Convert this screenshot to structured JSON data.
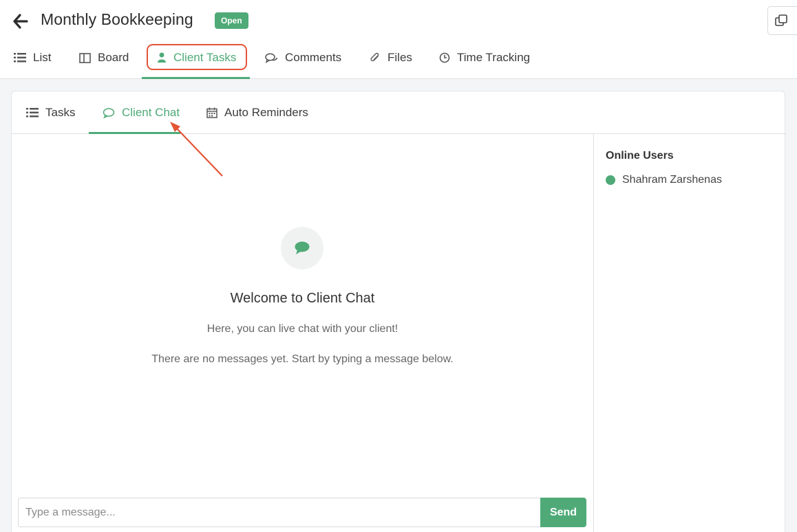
{
  "header": {
    "title": "Monthly Bookkeeping",
    "status": "Open"
  },
  "main_tabs": [
    {
      "label": "List",
      "icon": "list-icon"
    },
    {
      "label": "Board",
      "icon": "board-icon"
    },
    {
      "label": "Client Tasks",
      "icon": "user-icon",
      "active": true
    },
    {
      "label": "Comments",
      "icon": "comments-icon"
    },
    {
      "label": "Files",
      "icon": "paperclip-icon"
    },
    {
      "label": "Time Tracking",
      "icon": "clock-icon"
    }
  ],
  "sub_tabs": [
    {
      "label": "Tasks",
      "icon": "list-icon"
    },
    {
      "label": "Client Chat",
      "icon": "chat-bubble-icon",
      "active": true
    },
    {
      "label": "Auto Reminders",
      "icon": "calendar-icon"
    }
  ],
  "chat": {
    "welcome_title": "Welcome to Client Chat",
    "welcome_subtitle": "Here, you can live chat with your client!",
    "empty_hint": "There are no messages yet. Start by typing a message below.",
    "input_placeholder": "Type a message...",
    "send_label": "Send"
  },
  "online": {
    "title": "Online Users",
    "users": [
      {
        "name": "Shahram Zarshenas",
        "status": "online"
      }
    ]
  },
  "colors": {
    "accent": "#4faa78",
    "annotation": "#e45436"
  }
}
